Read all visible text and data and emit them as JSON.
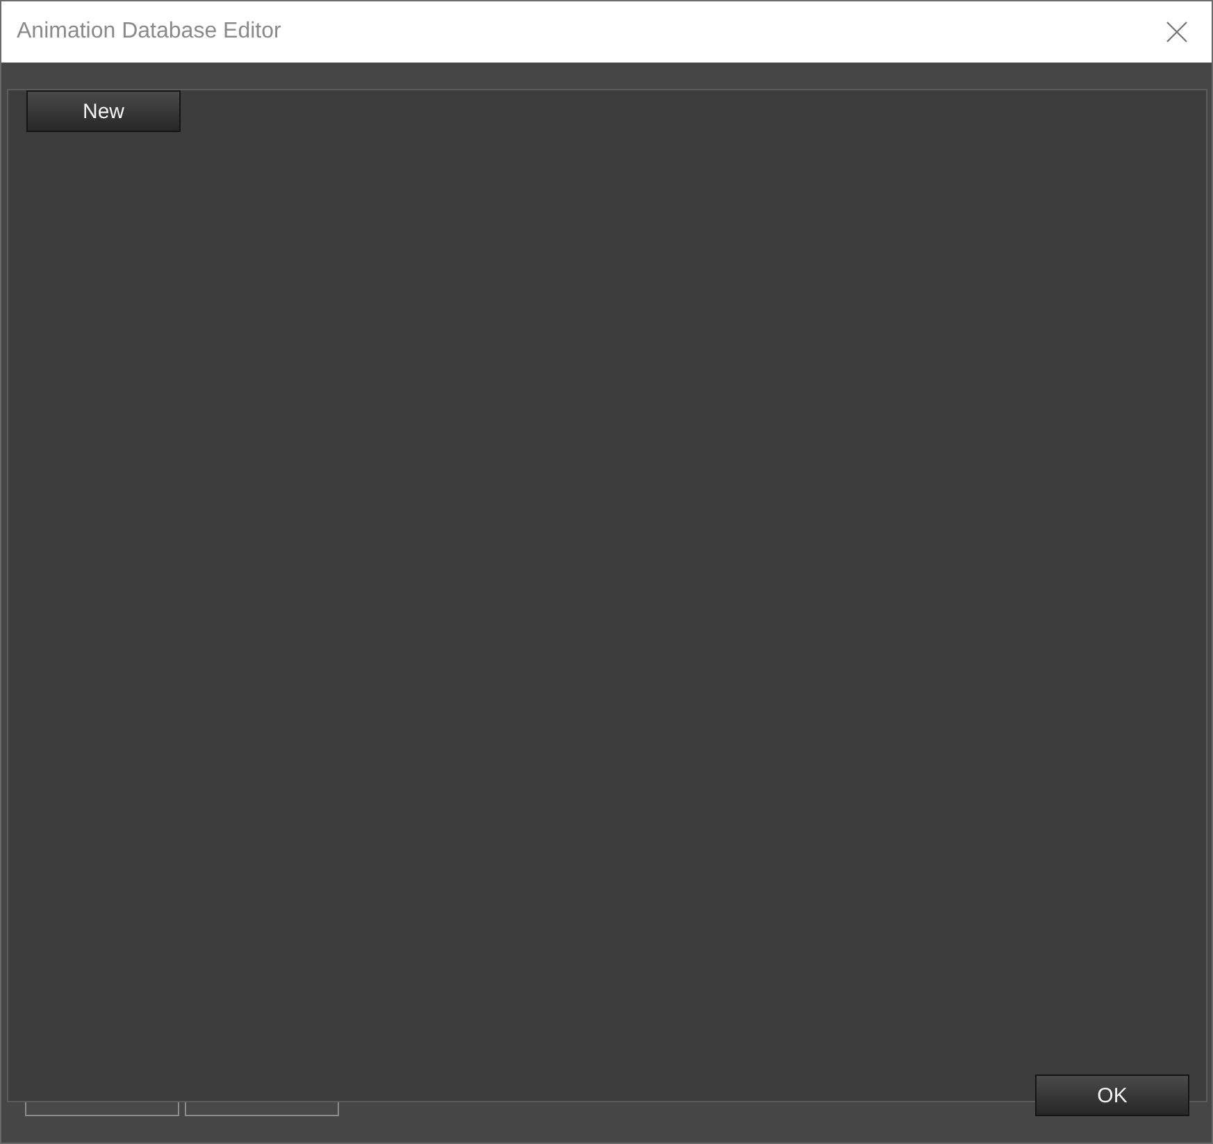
{
  "window": {
    "title": "Animation Database Editor"
  },
  "panel": {
    "new_button": "New",
    "ok_button": "OK"
  }
}
